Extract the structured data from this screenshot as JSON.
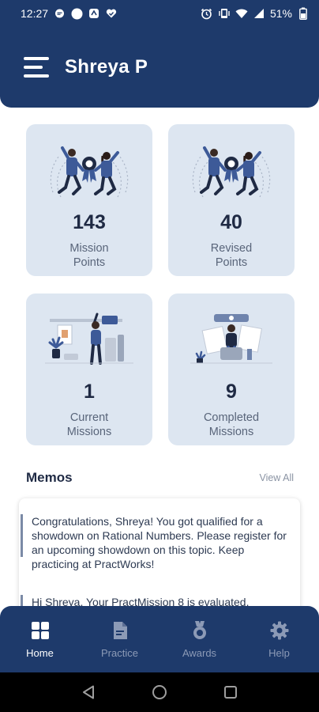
{
  "status_bar": {
    "time": "12:27",
    "battery": "51%"
  },
  "header": {
    "user_name": "Shreya P"
  },
  "stats": [
    {
      "value": "143",
      "label_line1": "Mission",
      "label_line2": "Points"
    },
    {
      "value": "40",
      "label_line1": "Revised",
      "label_line2": "Points"
    },
    {
      "value": "1",
      "label_line1": "Current",
      "label_line2": "Missions"
    },
    {
      "value": "9",
      "label_line1": "Completed",
      "label_line2": "Missions"
    }
  ],
  "memos": {
    "title": "Memos",
    "view_all": "View All",
    "items": [
      "Congratulations, Shreya! You got qualified for a showdown on Rational Numbers. Please register for an upcoming showdown on this topic. Keep practicing at PractWorks!",
      "Hi Shreya, Your PractMission 8 is evaluated."
    ]
  },
  "bottom_nav": {
    "items": [
      {
        "label": "Home",
        "icon": "grid-icon",
        "active": true
      },
      {
        "label": "Practice",
        "icon": "document-icon",
        "active": false
      },
      {
        "label": "Awards",
        "icon": "medal-icon",
        "active": false
      },
      {
        "label": "Help",
        "icon": "gear-icon",
        "active": false
      }
    ]
  },
  "colors": {
    "primary": "#1e3a6b",
    "card_bg": "#dde6f1",
    "nav_inactive": "#8c9ab6",
    "text_dark": "#1f2a44"
  }
}
